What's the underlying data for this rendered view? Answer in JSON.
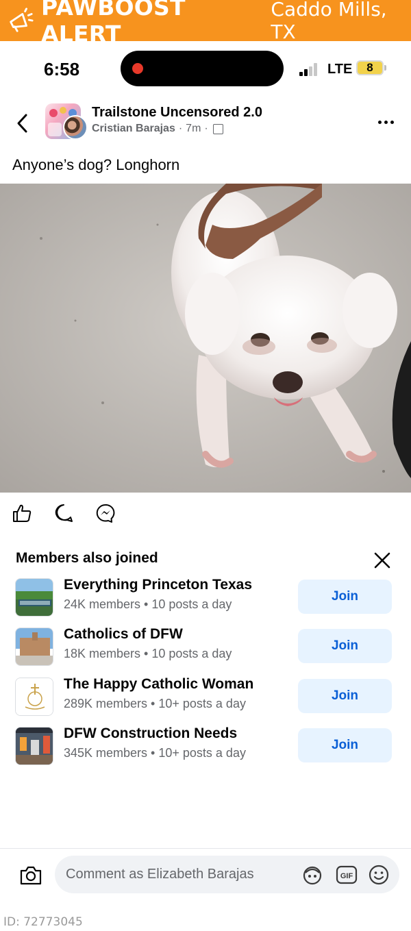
{
  "banner": {
    "brand": "PAWBOOST ALERT",
    "location": "Caddo Mills, TX",
    "color": "#f7931e",
    "icon": "megaphone-icon"
  },
  "status_bar": {
    "time": "6:58",
    "network": "LTE",
    "battery": "8",
    "signal_bars_filled": 2,
    "signal_bars_total": 4
  },
  "post": {
    "group_name": "Trailstone Uncensored 2.0",
    "author": "Cristian Barajas",
    "time_ago": "7m",
    "text": "Anyone’s dog? Longhorn",
    "photo_alt": "white-dog-photo",
    "actions": [
      "like-icon",
      "comment-icon",
      "messenger-icon"
    ]
  },
  "members_also_joined": {
    "title": "Members also joined",
    "groups": [
      {
        "name": "Everything Princeton Texas",
        "stats": "24K members • 10 posts a day",
        "join_label": "Join"
      },
      {
        "name": "Catholics of DFW",
        "stats": "18K members • 10 posts a day",
        "join_label": "Join"
      },
      {
        "name": "The Happy Catholic Woman",
        "stats": "289K members • 10+ posts a day",
        "join_label": "Join"
      },
      {
        "name": "DFW Construction Needs",
        "stats": "345K members • 10+ posts a day",
        "join_label": "Join"
      }
    ]
  },
  "comment_bar": {
    "placeholder": "Comment as Elizabeth Barajas",
    "gif_label": "GIF"
  },
  "footer": {
    "id": "ID: 72773045"
  },
  "colors": {
    "accent_blue": "#0a5fd6",
    "join_bg": "#e7f3ff",
    "muted_text": "#65676b"
  }
}
